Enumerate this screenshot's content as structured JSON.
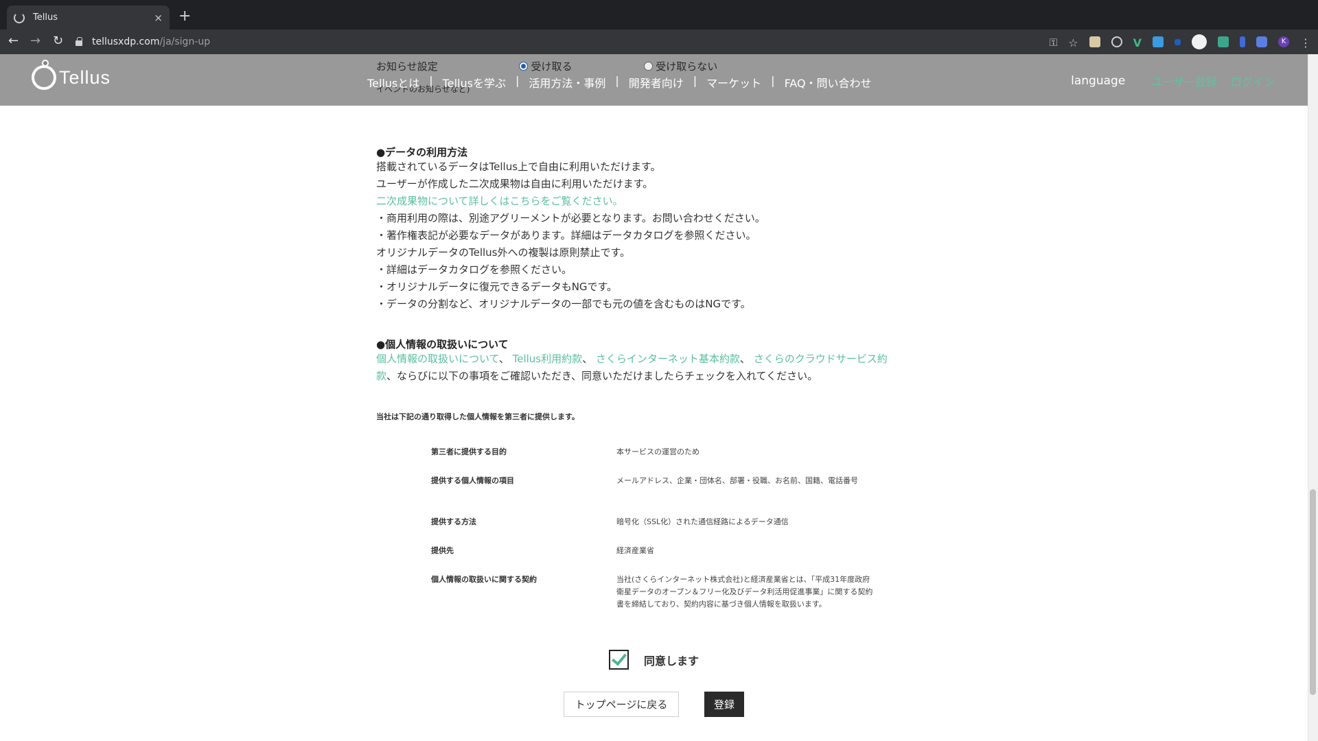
{
  "browser": {
    "tab_title": "Tellus",
    "tab_close": "×",
    "new_tab": "+",
    "url_host": "tellusxdp.com",
    "url_path": "/ja/sign-up",
    "profile_initial": "K"
  },
  "header": {
    "logo_text": "Tellus",
    "behind_prefs": {
      "label": "お知らせ設定",
      "option_on": "受け取る",
      "option_off": "受け取らない",
      "sub_note": "イベントのお知らせなど)"
    },
    "nav": [
      "Tellusとは",
      "Tellusを学ぶ",
      "活用方法・事例",
      "開発者向け",
      "マーケット",
      "FAQ・問い合わせ"
    ],
    "nav_sep": "|",
    "language": "language",
    "signup": "ユーザー登録",
    "login": "ログイン"
  },
  "data_usage": {
    "heading": "●データの利用方法",
    "line1": "搭載されているデータはTellus上で自由に利用いただけます。",
    "line2": "ユーザーが作成した二次成果物は自由に利用いただけます。",
    "link": "二次成果物について詳しくはこちらをご覧ください。",
    "line3": "・商用利用の際は、別途アグリーメントが必要となります。お問い合わせください。",
    "line4": "・著作権表記が必要なデータがあります。詳細はデータカタログを参照ください。",
    "line5": "オリジナルデータのTellus外への複製は原則禁止です。",
    "line6": "・詳細はデータカタログを参照ください。",
    "line7": "・オリジナルデータに復元できるデータもNGです。",
    "line8": "・データの分割など、オリジナルデータの一部でも元の値を含むものはNGです。"
  },
  "privacy": {
    "heading": "●個人情報の取扱いについて",
    "link1": "個人情報の取扱いについて",
    "link2": "Tellus利用約款",
    "link3": "さくらインターネット基本約款",
    "link4a": "さくらのクラウドサービス約",
    "link4b": "款",
    "comma": "、",
    "tail": "、ならびに以下の事項をご確認いただき、同意いただけましたらチェックを入れてください。",
    "third_party_note": "当社は下記の通り取得した個人情報を第三者に提供します。",
    "table": [
      {
        "k": "第三者に提供する目的",
        "v": "本サービスの運営のため"
      },
      {
        "k": "提供する個人情報の項目",
        "v": "メールアドレス、企業・団体名、部署・役職、お名前、国籍、電話番号"
      },
      {
        "k": "提供する方法",
        "v": "暗号化（SSL化）された通信経路によるデータ通信"
      },
      {
        "k": "提供先",
        "v": "経済産業省"
      },
      {
        "k": "個人情報の取扱いに関する契約",
        "v": "当社(さくらインターネット株式会社)と経済産業省とは、「平成31年度政府衛星データのオープン＆フリー化及びデータ利活用促進事業」に関する契約書を締結しており、契約内容に基づき個人情報を取扱います。"
      }
    ]
  },
  "form": {
    "agree_label": "同意します",
    "back_button": "トップページに戻る",
    "register_button": "登録"
  }
}
